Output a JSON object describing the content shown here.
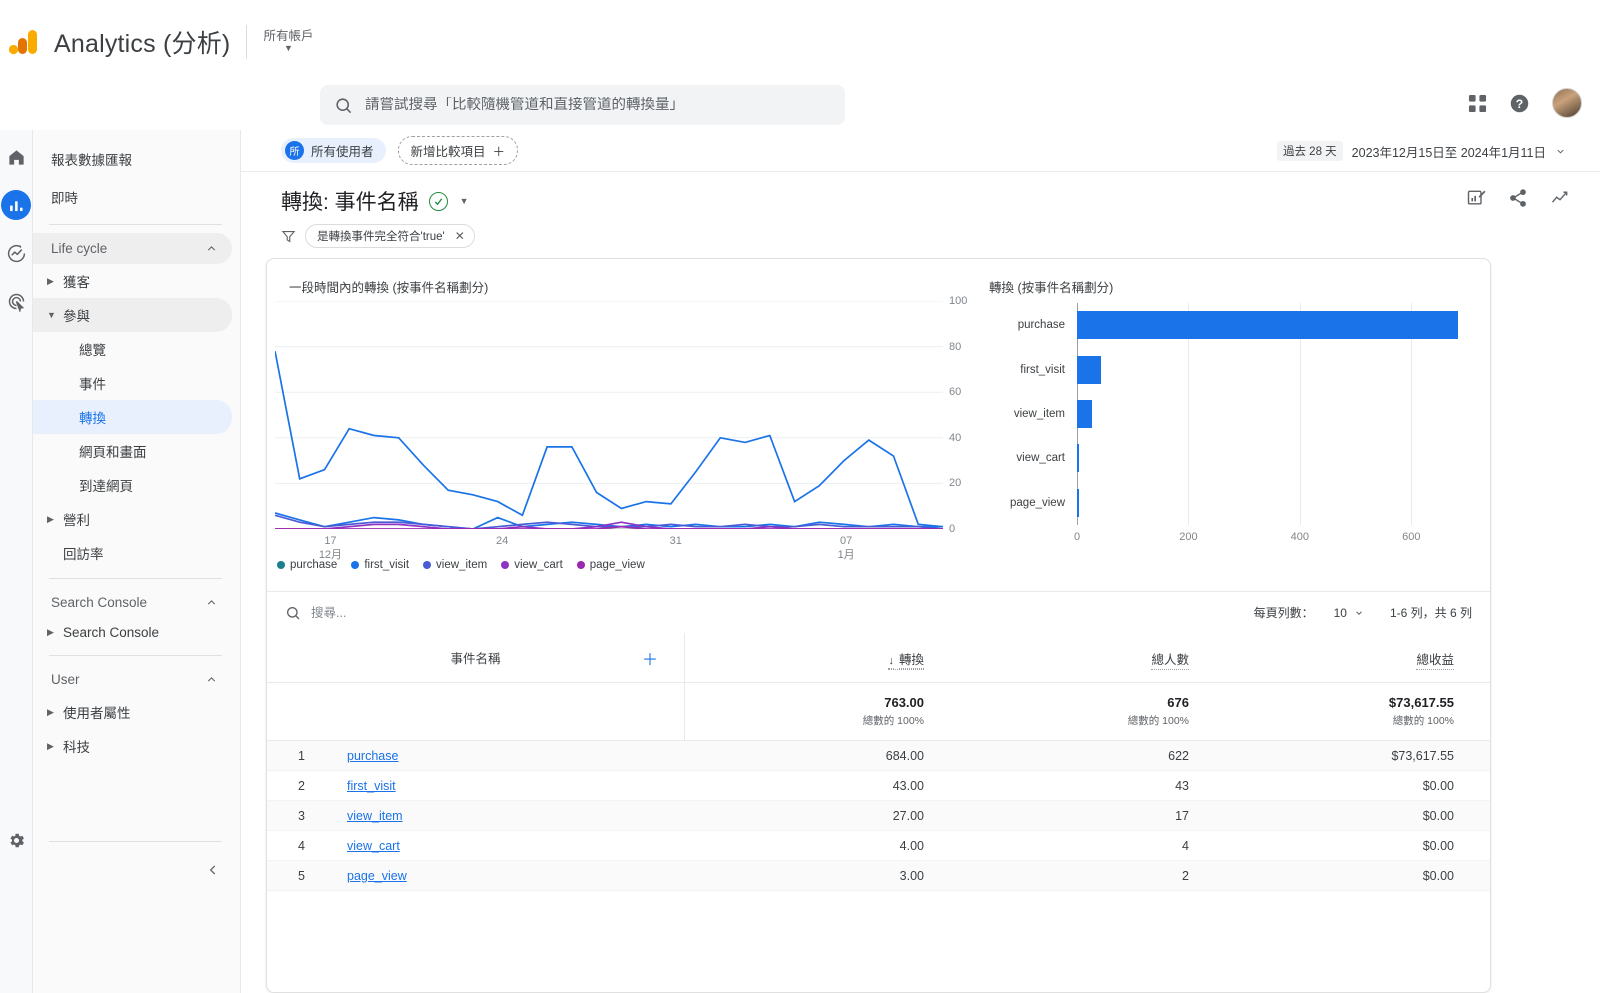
{
  "header": {
    "brand": "Analytics (分析)",
    "account_label": "所有帳戶",
    "search_placeholder": "請嘗試搜尋「比較隨機管道和直接管道的轉換量」",
    "search_value": "",
    "icons": {
      "search": "search-icon",
      "apps": "apps-grid-icon",
      "help": "help-icon",
      "avatar": "user-avatar"
    }
  },
  "rail": {
    "items": [
      {
        "name": "home-icon",
        "label": "首頁"
      },
      {
        "name": "reports-icon",
        "label": "報表"
      },
      {
        "name": "explore-icon",
        "label": "探索"
      },
      {
        "name": "advertising-icon",
        "label": "廣告"
      }
    ],
    "settings_label": "管理"
  },
  "sidebar": {
    "top_items": [
      {
        "label": "報表數據匯報"
      },
      {
        "label": "即時"
      }
    ],
    "sections": [
      {
        "title": "Life cycle",
        "items": [
          {
            "label": "獲客",
            "expandable": true,
            "expanded": false
          },
          {
            "label": "參與",
            "expandable": true,
            "expanded": true,
            "highlight": true
          },
          {
            "label": "總覽",
            "sub": true
          },
          {
            "label": "事件",
            "sub": true
          },
          {
            "label": "轉換",
            "sub": true,
            "selected": true
          },
          {
            "label": "網頁和畫面",
            "sub": true
          },
          {
            "label": "到達網頁",
            "sub": true
          },
          {
            "label": "營利",
            "expandable": true,
            "expanded": false
          },
          {
            "label": "回訪率",
            "expandable": false
          }
        ]
      },
      {
        "title": "Search Console",
        "items": [
          {
            "label": "Search Console",
            "expandable": true,
            "expanded": false
          }
        ]
      },
      {
        "title": "User",
        "items": [
          {
            "label": "使用者屬性",
            "expandable": true,
            "expanded": false
          },
          {
            "label": "科技",
            "expandable": true,
            "expanded": false
          }
        ]
      }
    ],
    "collapse_label": "收合"
  },
  "toolbar": {
    "audience_chip": {
      "badge": "所",
      "label": "所有使用者"
    },
    "add_comparison": "新增比較項目",
    "date_badge": "過去 28 天",
    "date_range": "2023年12月15日至 2024年1月11日"
  },
  "report": {
    "title": "轉換: 事件名稱",
    "filter_chip": "是轉換事件完全符合'true'",
    "header_icons": [
      {
        "name": "customize-report-icon"
      },
      {
        "name": "share-icon"
      },
      {
        "name": "insights-icon"
      }
    ]
  },
  "chart_data": [
    {
      "type": "line",
      "title": "一段時間內的轉換 (按事件名稱劃分)",
      "xlabel": "",
      "ylabel": "",
      "ylim": [
        0,
        100
      ],
      "yticks": [
        0,
        20,
        40,
        60,
        80,
        100
      ],
      "grid": true,
      "legend_position": "bottom",
      "xtick_labels": [
        {
          "pos": 0.083,
          "top": "17",
          "bottom": "12月"
        },
        {
          "pos": 0.34,
          "top": "24",
          "bottom": ""
        },
        {
          "pos": 0.6,
          "top": "31",
          "bottom": ""
        },
        {
          "pos": 0.855,
          "top": "07",
          "bottom": "1月"
        }
      ],
      "series": [
        {
          "name": "purchase",
          "color": "#1a73e8",
          "values": [
            78,
            22,
            26,
            44,
            41,
            40,
            28,
            17,
            15,
            12,
            6,
            36,
            36,
            16,
            9,
            12,
            11,
            25,
            40,
            38,
            41,
            12,
            19,
            30,
            39,
            32,
            2,
            1
          ]
        },
        {
          "name": "first_visit",
          "color": "#1a73e8",
          "values": [
            7,
            4,
            1,
            3,
            5,
            4,
            2,
            1,
            0,
            5,
            1,
            2,
            3,
            2,
            1,
            2,
            1,
            2,
            1,
            1,
            2,
            1,
            3,
            2,
            1,
            2,
            1,
            1
          ]
        },
        {
          "name": "view_item",
          "color": "#4a5bd6",
          "values": [
            6,
            3,
            1,
            2,
            3,
            3,
            2,
            1,
            0,
            1,
            2,
            3,
            2,
            1,
            1,
            1,
            2,
            1,
            1,
            2,
            1,
            1,
            2,
            1,
            1,
            1,
            1,
            0
          ]
        },
        {
          "name": "view_cart",
          "color": "#8e32c4",
          "values": [
            0,
            0,
            0,
            1,
            2,
            2,
            1,
            0,
            0,
            0,
            1,
            0,
            0,
            1,
            3,
            1,
            0,
            0,
            0,
            0,
            1,
            0,
            0,
            0,
            0,
            0,
            0,
            0
          ]
        },
        {
          "name": "page_view",
          "color": "#9c27b0",
          "values": [
            0,
            0,
            0,
            0,
            0,
            0,
            0,
            0,
            0,
            0,
            0,
            0,
            0,
            0,
            1,
            0,
            0,
            0,
            0,
            0,
            0,
            0,
            0,
            0,
            0,
            0,
            0,
            0
          ]
        }
      ],
      "legend": [
        {
          "label": "purchase",
          "color": "#1a7f8e"
        },
        {
          "label": "first_visit",
          "color": "#1a73e8"
        },
        {
          "label": "view_item",
          "color": "#4a5bd6"
        },
        {
          "label": "view_cart",
          "color": "#8e32c4"
        },
        {
          "label": "page_view",
          "color": "#9c27b0"
        }
      ]
    },
    {
      "type": "bar",
      "orientation": "horizontal",
      "title": "轉換 (按事件名稱劃分)",
      "categories": [
        "purchase",
        "first_visit",
        "view_item",
        "view_cart",
        "page_view"
      ],
      "values": [
        684,
        43,
        27,
        4,
        3
      ],
      "xlim": [
        0,
        700
      ],
      "xticks": [
        0,
        200,
        400,
        600
      ],
      "bar_color": "#1a73e8",
      "xlabel": "",
      "ylabel": "",
      "grid": true
    }
  ],
  "table": {
    "search_placeholder": "搜尋...",
    "rows_per_page_label": "每頁列數：",
    "rows_per_page_value": "10",
    "pagination": "1-6 列，共 6 列",
    "columns": [
      {
        "label": "事件名稱",
        "type": "dimension"
      },
      {
        "label": "轉換",
        "type": "metric",
        "sorted": true,
        "sort_dir": "desc"
      },
      {
        "label": "總人數",
        "type": "metric"
      },
      {
        "label": "總收益",
        "type": "metric"
      }
    ],
    "totals": [
      {
        "value": "763.00",
        "pct": "總數的 100%"
      },
      {
        "value": "676",
        "pct": "總數的 100%"
      },
      {
        "value": "$73,617.55",
        "pct": "總數的 100%"
      }
    ],
    "rows": [
      {
        "idx": "1",
        "name": "purchase",
        "conversions": "684.00",
        "users": "622",
        "revenue": "$73,617.55"
      },
      {
        "idx": "2",
        "name": "first_visit",
        "conversions": "43.00",
        "users": "43",
        "revenue": "$0.00"
      },
      {
        "idx": "3",
        "name": "view_item",
        "conversions": "27.00",
        "users": "17",
        "revenue": "$0.00"
      },
      {
        "idx": "4",
        "name": "view_cart",
        "conversions": "4.00",
        "users": "4",
        "revenue": "$0.00"
      },
      {
        "idx": "5",
        "name": "page_view",
        "conversions": "3.00",
        "users": "2",
        "revenue": "$0.00"
      }
    ]
  },
  "colors": {
    "accent": "#1a73e8",
    "accent_bg": "#e8f0fe",
    "green": "#1e8e3e",
    "text": "#3c4043",
    "muted": "#5f6368"
  }
}
